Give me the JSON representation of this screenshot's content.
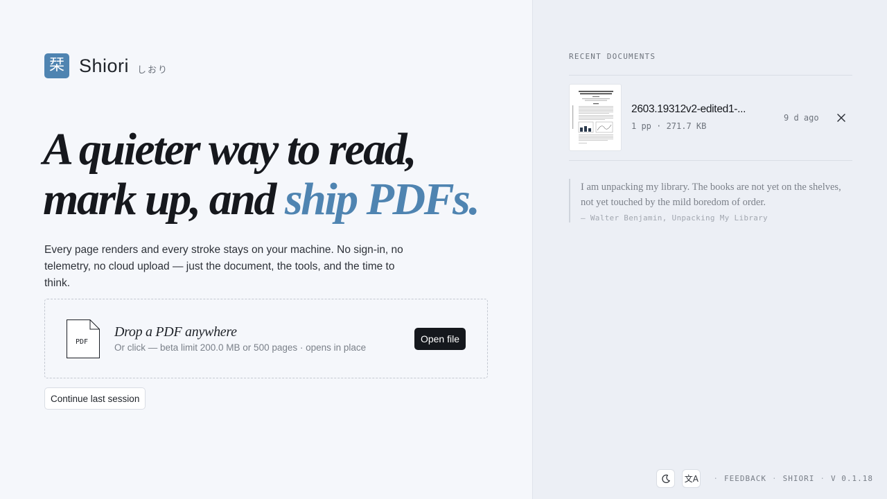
{
  "brand": {
    "logo_glyph": "栞",
    "name": "Shiori",
    "kana": "しおり",
    "accent_color": "#4f84b1"
  },
  "hero": {
    "headline_line1": "A quieter way to read,",
    "headline_line2_a": "mark up, and ",
    "headline_line2_accent": "ship PDFs.",
    "lede": "Every page renders and every stroke stays on your machine. No sign-in, no telemetry, no cloud upload — just the document, the tools, and the time to think."
  },
  "dropzone": {
    "icon_label": "PDF",
    "title": "Drop a PDF anywhere",
    "subtitle": "Or click — beta limit 200.0 MB or 500 pages · opens in place",
    "open_label": "Open file"
  },
  "continue_label": "Continue last session",
  "recent": {
    "title": "RECENT DOCUMENTS",
    "items": [
      {
        "name": "2603.19312v2-edited1-...",
        "meta": "1 pp · 271.7 KB",
        "age": "9 d ago",
        "close_icon": "close-icon"
      }
    ]
  },
  "quote": {
    "text": "I am unpacking my library. The books are not yet on the shelves, not yet touched by the mild boredom of order.",
    "cite": "— Walter Benjamin, Unpacking My Library"
  },
  "footer": {
    "theme_icon": "moon-icon",
    "lang_icon": "translate-icon",
    "lang_glyph": "文A",
    "feedback": "FEEDBACK",
    "app": "SHIORI",
    "version": "V 0.1.18"
  }
}
